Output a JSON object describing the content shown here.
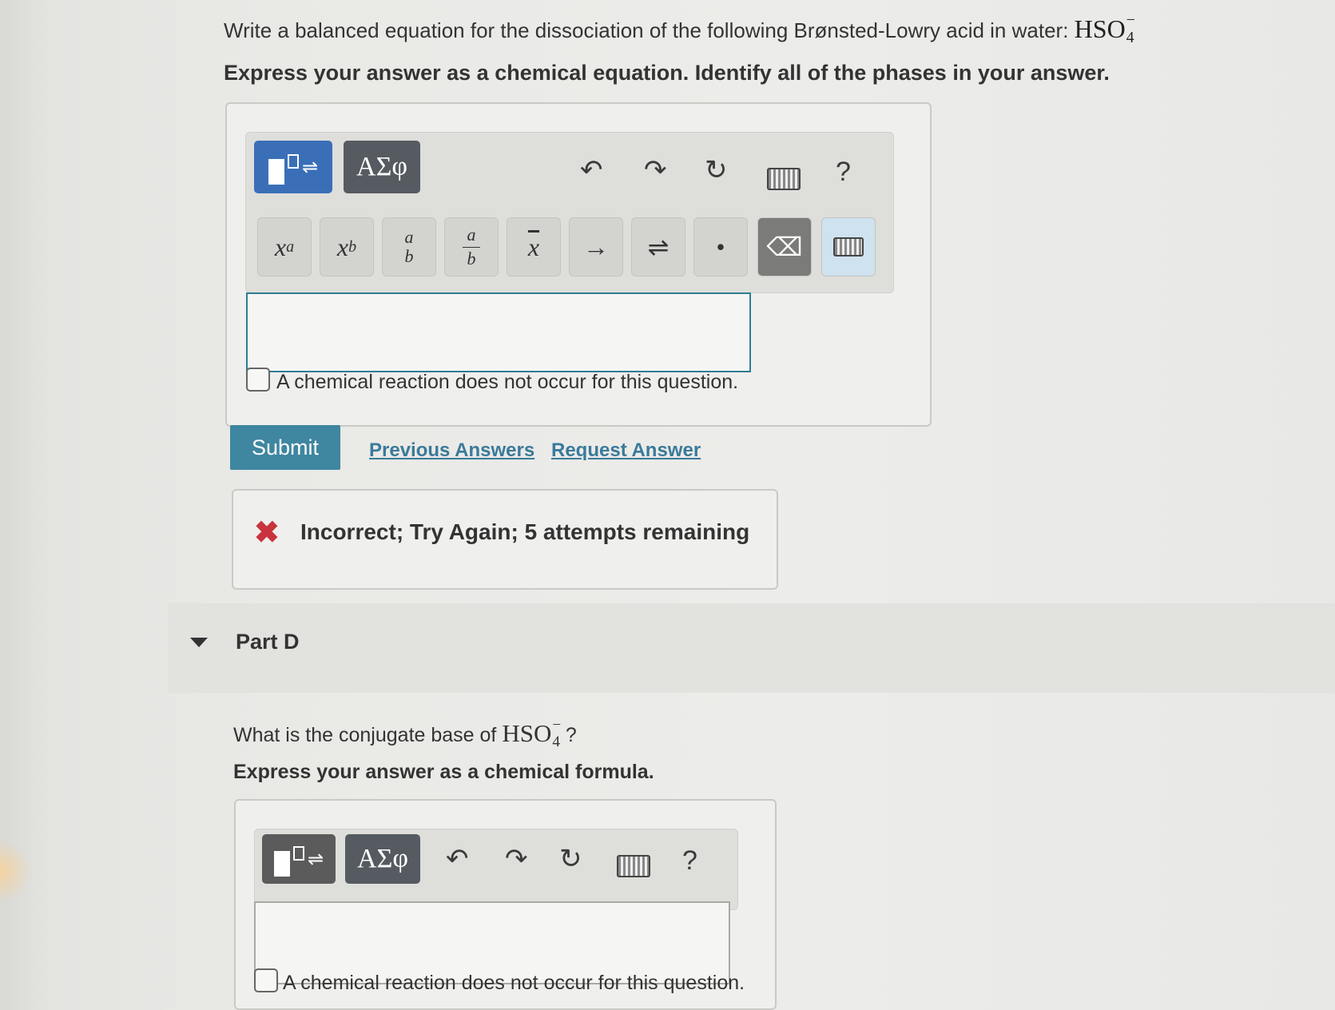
{
  "question": {
    "prompt": "Write a balanced equation for the dissociation of the following Brønsted-Lowry acid in water: ",
    "species_base": "HSO",
    "species_sub": "4",
    "species_sup": "−",
    "instruction": "Express your answer as a chemical equation. Identify all of the phases in your answer."
  },
  "toolbar": {
    "template_button_label": "□⇌",
    "greek_button_label": "ΑΣφ",
    "undo_icon": "↶",
    "redo_icon": "↷",
    "reset_icon": "↻",
    "help_label": "?"
  },
  "keys": {
    "superscript": "xa",
    "subscript": "xb",
    "arrow": "→",
    "equilibrium": "⇌",
    "dot": "•",
    "backspace": "⌫"
  },
  "checkbox_label": "A chemical reaction does not occur for this question.",
  "actions": {
    "submit": "Submit",
    "previous_answers": "Previous Answers",
    "request_answer": "Request Answer"
  },
  "feedback": {
    "icon": "✖",
    "message": "Incorrect; Try Again; 5 attempts remaining"
  },
  "part_d": {
    "title": "Part D",
    "question_prefix": "What is the conjugate base of ",
    "species_base": "HSO",
    "species_sub": "4",
    "species_sup": "−",
    "question_suffix": " ?",
    "instruction": "Express your answer as a chemical formula.",
    "checkbox_label_partial": "A chemical reaction does not occur for this question."
  },
  "colors": {
    "accent_blue": "#3a6fb7",
    "submit_teal": "#3f86a0",
    "error_red": "#c8333e",
    "input_border": "#2f7d92"
  }
}
